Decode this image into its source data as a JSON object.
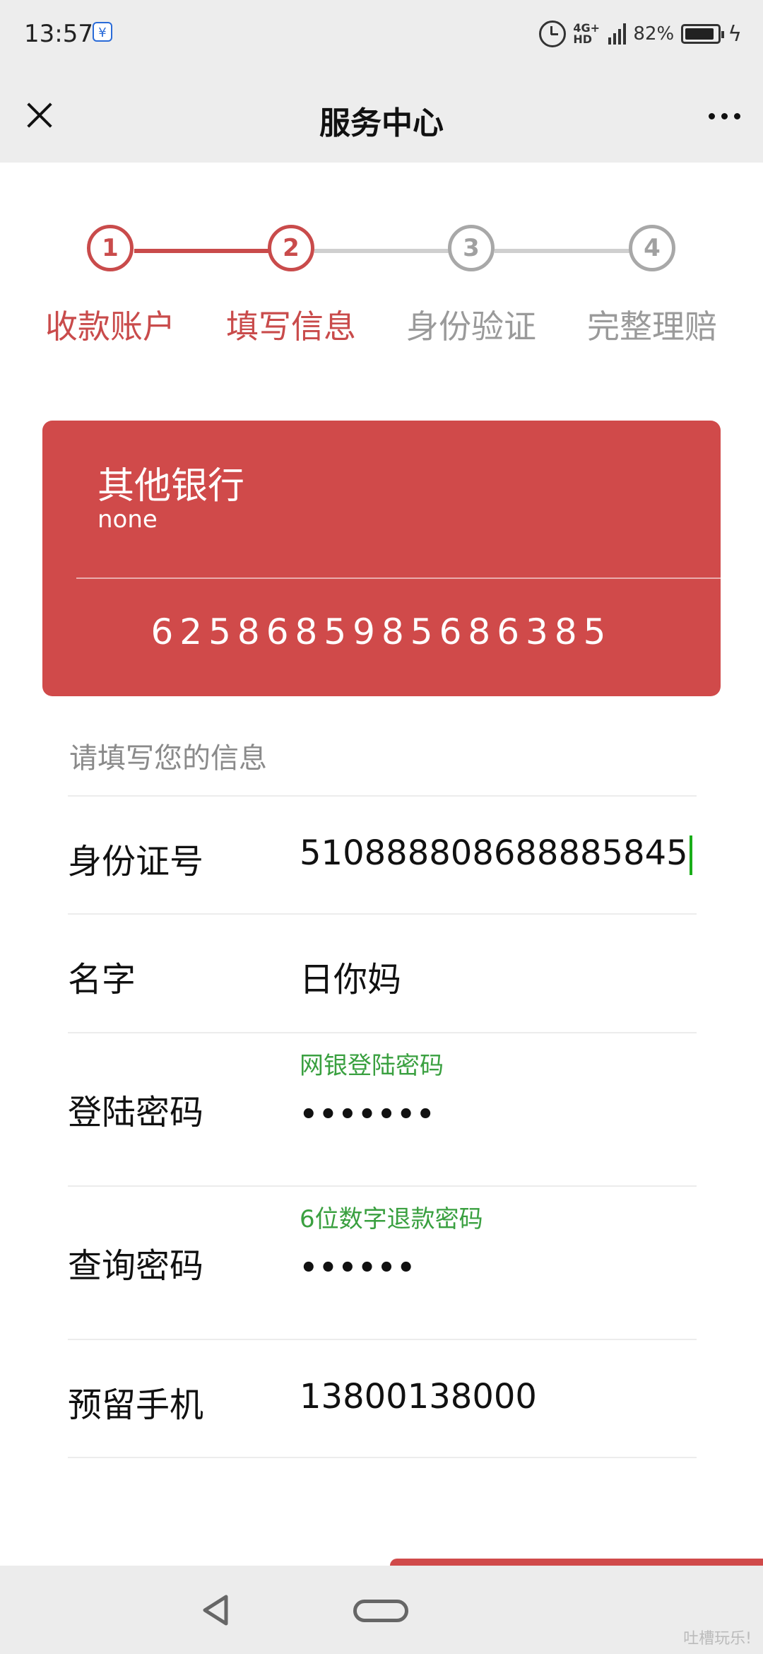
{
  "status_bar": {
    "time": "13:57",
    "app_icon": "payment-app-icon",
    "network": "4G+ HD",
    "battery_percent": "82%",
    "battery_level": 0.82
  },
  "title_bar": {
    "title": "服务中心",
    "close_icon": "close-icon",
    "more_icon": "more-icon"
  },
  "steps": [
    {
      "number": "1",
      "label": "收款账户",
      "active": true
    },
    {
      "number": "2",
      "label": "填写信息",
      "active": true
    },
    {
      "number": "3",
      "label": "身份验证",
      "active": false
    },
    {
      "number": "4",
      "label": "完整理赔",
      "active": false
    }
  ],
  "card": {
    "bank_name": "其他银行",
    "subtitle": "none",
    "number": "6258685985686385",
    "color": "#d04a4a"
  },
  "form": {
    "section_title": "请填写您的信息",
    "fields": [
      {
        "label": "身份证号",
        "value": "510888808688885845",
        "hint": ""
      },
      {
        "label": "名字",
        "value": "日你妈",
        "hint": ""
      },
      {
        "label": "登陆密码",
        "value": "•••••••",
        "hint": "网银登陆密码"
      },
      {
        "label": "查询密码",
        "value": "••••••",
        "hint": "6位数字退款密码"
      },
      {
        "label": "预留手机",
        "value": "13800138000",
        "hint": ""
      }
    ]
  },
  "colors": {
    "accent": "#c94b4b",
    "inactive": "#a8a8a8",
    "hint": "#3aa040"
  },
  "watermark": "吐槽玩乐!"
}
